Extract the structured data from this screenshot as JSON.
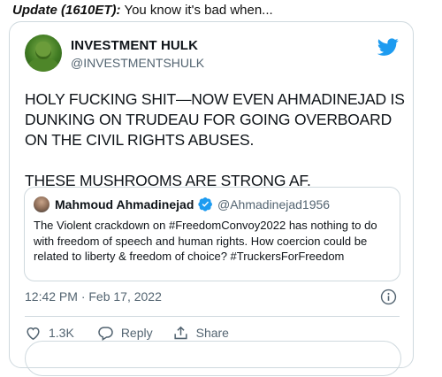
{
  "update": {
    "label": "Update (1610ET):",
    "text": "You know it's bad when..."
  },
  "tweet": {
    "author_name": "INVESTMENT HULK",
    "author_handle": "@INVESTMENTSHULK",
    "body": "HOLY FUCKING SHIT—NOW EVEN AHMADINEJAD IS DUNKING ON TRUDEAU FOR GOING OVERBOARD ON THE CIVIL RIGHTS ABUSES.\n\nTHESE MUSHROOMS ARE STRONG AF.",
    "timestamp": "12:42 PM · Feb 17, 2022",
    "like_count": "1.3K",
    "reply_label": "Reply",
    "share_label": "Share"
  },
  "quoted_tweet": {
    "author_name": "Mahmoud Ahmadinejad",
    "author_handle": "@Ahmadinejad1956",
    "text": "The Violent crackdown on #FreedomConvoy2022 has nothing to do with freedom of speech and human rights. How coercion could be related to liberty & freedom of choice? #TruckersForFreedom"
  },
  "icons": {
    "brand": "twitter-bird-icon",
    "verified": "verified-badge-icon",
    "info": "info-icon",
    "like": "heart-icon",
    "reply": "reply-bubble-icon",
    "share": "share-icon"
  },
  "colors": {
    "twitter_blue": "#1d9bf0",
    "muted_text": "#536471",
    "border": "#cfd9de"
  }
}
